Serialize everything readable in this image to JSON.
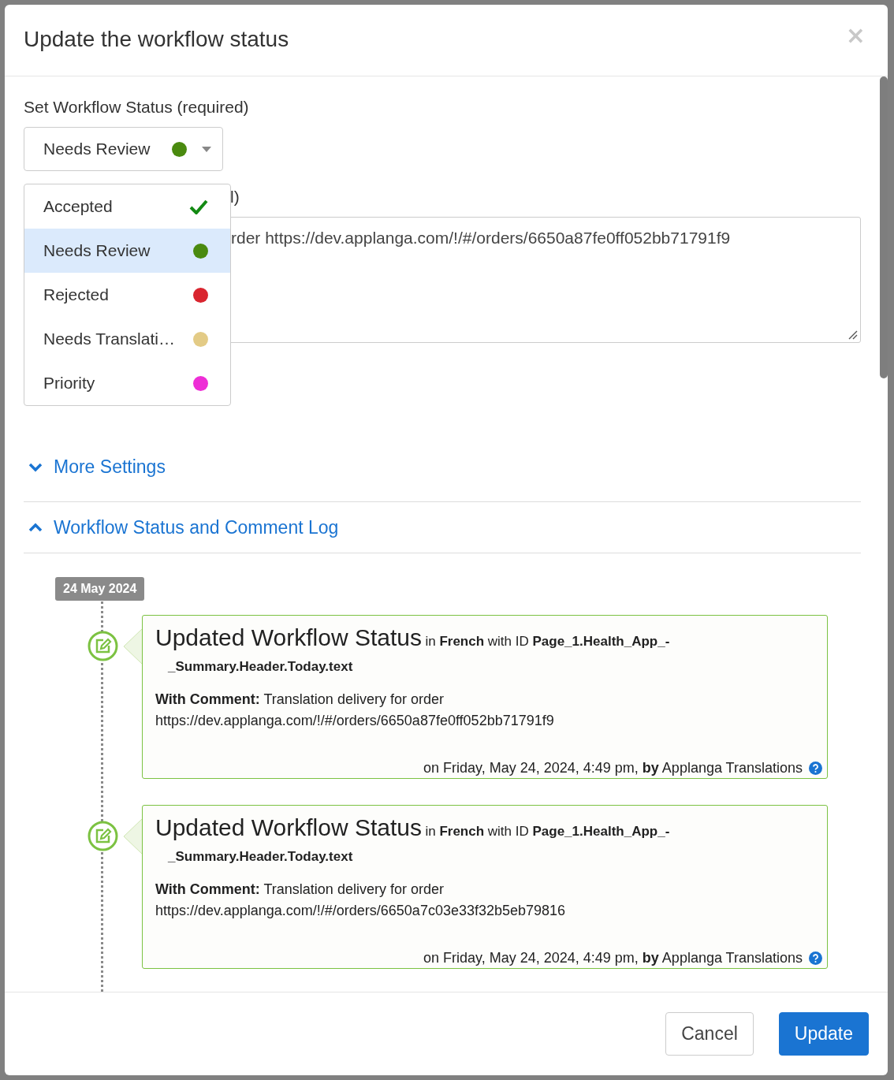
{
  "dialog": {
    "title": "Update the workflow status",
    "close": "×"
  },
  "status_field": {
    "label": "Set Workflow Status (required)",
    "value": "Needs Review",
    "color": "#4a8a0f"
  },
  "status_menu": [
    {
      "label": "Accepted",
      "selected": false,
      "kind": "check",
      "color": "#138a13"
    },
    {
      "label": "Needs Review",
      "selected": true,
      "kind": "dot",
      "color": "#4a8a0f"
    },
    {
      "label": "Rejected",
      "selected": false,
      "kind": "dot",
      "color": "#d9252f"
    },
    {
      "label": "Needs Translati…",
      "selected": false,
      "kind": "dot",
      "color": "#e3cb86"
    },
    {
      "label": "Priority",
      "selected": false,
      "kind": "dot",
      "color": "#ee2ed6"
    }
  ],
  "comment": {
    "label_fragment": "l)",
    "value_fragment": "rder https://dev.applanga.com/!/#/orders/6650a87fe0ff052bb71791f9"
  },
  "sections": [
    {
      "label": "More Settings",
      "expanded": false
    },
    {
      "label": "Workflow Status and Comment Log",
      "expanded": true
    }
  ],
  "log": {
    "date": "24 May 2024",
    "entries": [
      {
        "title": "Updated Workflow Status",
        "meta": "in **French** with ID **Page_1.Health_App_-_Summary.Header.Today.text**",
        "comment": "**With Comment:**  Translation delivery for order https://dev.applanga.com/!/#/orders/6650a87fe0ff052bb71791f9",
        "footer": "on Friday, May 24, 2024, 4:49 pm, **by** Applanga Translations"
      },
      {
        "title": "Updated Workflow Status",
        "meta": "in **French** with ID **Page_1.Health_App_-_Summary.Header.Today.text**",
        "comment": "**With Comment:**  Translation delivery for order https://dev.applanga.com/!/#/orders/6650a7c03e33f32b5eb79816",
        "footer": "on Friday, May 24, 2024, 4:49 pm, **by** Applanga Translations"
      }
    ]
  },
  "buttons": [
    {
      "label": "Cancel",
      "kind": "secondary"
    },
    {
      "label": "Update",
      "kind": "primary"
    }
  ]
}
